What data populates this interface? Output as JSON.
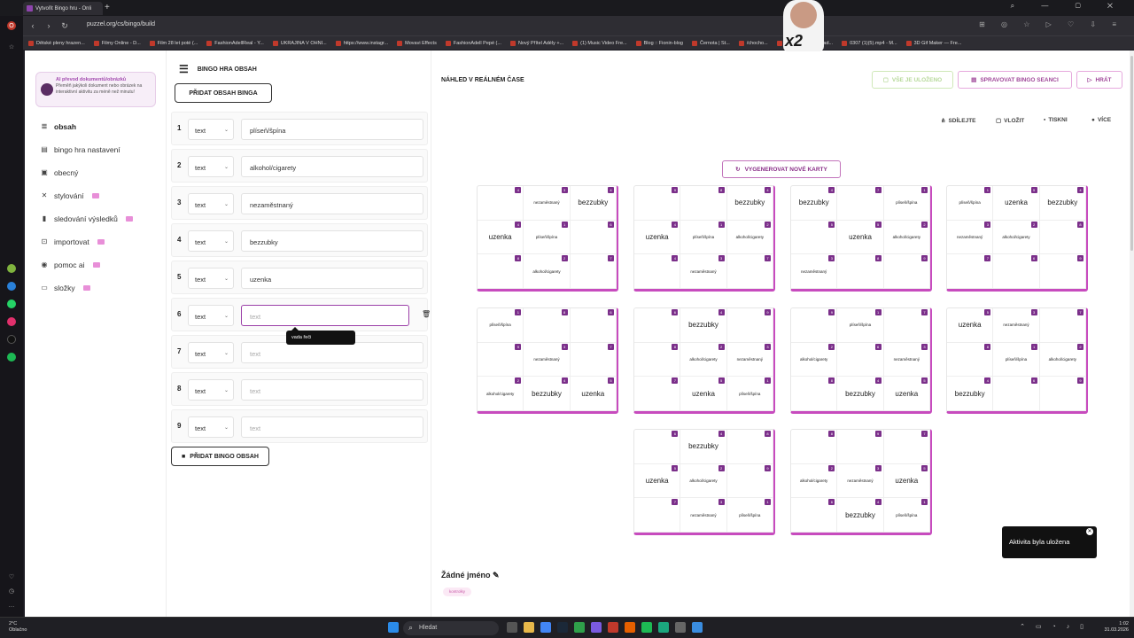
{
  "browser": {
    "tab_title": "Vytvořit Bingo hru - Onli",
    "url": "puzzel.org/cs/bingo/build",
    "bookmarks": [
      "Dětské pleny hrazen...",
      "Filmy Online - D...",
      "Film 28 let poté (...",
      "FashionAdellReal - Y...",
      "UKRAJINA V OHNI...",
      "https://www.instagr...",
      "Movavi Effects",
      "FashionAdell Pepé (...",
      "Nový Přítel Adély +...",
      "(1) Music Video Fre...",
      "Blog :: Fionin-blog",
      "Černota | St...",
      "/chocho...",
      "Kick VOD Download...",
      "0307 (1)(5).mp4 - M...",
      "3D Gif Maker — Fre..."
    ]
  },
  "sidebar": {
    "promo_title": "AI převod dokumentů/obrázků",
    "promo_text": "Přeměň jakýkoli dokument nebo obrázek na interaktivní aktivitu za méně než minutu!",
    "items": [
      {
        "label": "obsah",
        "icon": "list-icon"
      },
      {
        "label": "bingo hra nastavení",
        "icon": "settings-icon"
      },
      {
        "label": "obecný",
        "icon": "card-icon"
      },
      {
        "label": "stylování",
        "icon": "paint-icon"
      },
      {
        "label": "sledování výsledků",
        "icon": "chart-icon"
      },
      {
        "label": "importovat",
        "icon": "import-icon"
      },
      {
        "label": "pomoc ai",
        "icon": "ai-icon"
      },
      {
        "label": "složky",
        "icon": "folder-icon"
      }
    ]
  },
  "editor": {
    "title": "BINGO HRA OBSAH",
    "add_top": "PŘIDAT OBSAH BINGA",
    "add_bottom": "PŘIDAT BINGO OBSAH",
    "rows": [
      {
        "num": "1",
        "type": "text",
        "value": "plíseň/špína"
      },
      {
        "num": "2",
        "type": "text",
        "value": "alkohol/cigarety"
      },
      {
        "num": "3",
        "type": "text",
        "value": "nezaměstnaný"
      },
      {
        "num": "4",
        "type": "text",
        "value": "bezzubky"
      },
      {
        "num": "5",
        "type": "text",
        "value": "uzenka"
      },
      {
        "num": "6",
        "type": "text",
        "value": "",
        "placeholder": "text"
      },
      {
        "num": "7",
        "type": "text",
        "value": "",
        "placeholder": "text"
      },
      {
        "num": "8",
        "type": "text",
        "value": "",
        "placeholder": "text"
      },
      {
        "num": "9",
        "type": "text",
        "value": "",
        "placeholder": "text"
      }
    ],
    "tooltip": "vada řeči"
  },
  "preview": {
    "title": "NÁHLED V REÁLNÉM ČASE",
    "saved": "VŠE JE ULOŽENO",
    "manage": "SPRAVOVAT BINGO SEANCI",
    "play": "HRÁT",
    "share": "SDÍLEJTE",
    "embed": "VLOŽIT",
    "print": "TISKNI",
    "more": "VÍCE",
    "generate": "VYGENEROVAT NOVÉ KARTY",
    "name": "Žádné jméno",
    "tag": "kontrolky",
    "cards": [
      [
        [
          "",
          "4"
        ],
        [
          "nezaměstnaný",
          "3"
        ],
        [
          "bezzubky",
          "4"
        ],
        [
          "uzenka",
          "4"
        ],
        [
          "plíseň/špína",
          "1"
        ],
        [
          "",
          "6"
        ],
        [
          "",
          "8"
        ],
        [
          "alkohol/cigarety",
          "2"
        ],
        [
          "",
          "7"
        ]
      ],
      [
        [
          "",
          "9"
        ],
        [
          "",
          "8"
        ],
        [
          "bezzubky",
          "4"
        ],
        [
          "uzenka",
          "4"
        ],
        [
          "plíseň/špína",
          "1"
        ],
        [
          "alkohol/cigarety",
          "2"
        ],
        [
          "",
          "4"
        ],
        [
          "nezaměstnaný",
          "3"
        ],
        [
          "",
          "7"
        ]
      ],
      [
        [
          "bezzubky",
          "4"
        ],
        [
          "",
          "7"
        ],
        [
          "plíseň/špína",
          "1"
        ],
        [
          "",
          "5"
        ],
        [
          "uzenka",
          "5"
        ],
        [
          "alkohol/cigarety",
          "2"
        ],
        [
          "nezaměstnaný",
          "3"
        ],
        [
          "",
          "8"
        ],
        [
          "",
          "9"
        ]
      ],
      [
        [
          "plíseň/špína",
          "1"
        ],
        [
          "uzenka",
          "5"
        ],
        [
          "bezzubky",
          "4"
        ],
        [
          "nezaměstnaný",
          "3"
        ],
        [
          "alkohol/cigarety",
          "2"
        ],
        [
          "",
          "8"
        ],
        [
          "",
          "7"
        ],
        [
          "",
          "6"
        ],
        [
          "",
          "9"
        ]
      ],
      [
        [
          "plíseň/špína",
          "1"
        ],
        [
          "",
          "8"
        ],
        [
          "",
          "6"
        ],
        [
          "",
          "9"
        ],
        [
          "nezaměstnaný",
          "3"
        ],
        [
          "",
          "7"
        ],
        [
          "alkohol/cigarety",
          "2"
        ],
        [
          "bezzubky",
          "4"
        ],
        [
          "uzenka",
          "5"
        ]
      ],
      [
        [
          "",
          "6"
        ],
        [
          "bezzubky",
          "4"
        ],
        [
          "",
          "9"
        ],
        [
          "",
          "8"
        ],
        [
          "alkohol/cigarety",
          "2"
        ],
        [
          "nezaměstnaný",
          "3"
        ],
        [
          "",
          "7"
        ],
        [
          "uzenka",
          "5"
        ],
        [
          "plíseň/špína",
          "1"
        ]
      ],
      [
        [
          "",
          "9"
        ],
        [
          "plíseň/špína",
          "1"
        ],
        [
          "",
          "7"
        ],
        [
          "alkohol/cigarety",
          "2"
        ],
        [
          "",
          "6"
        ],
        [
          "nezaměstnaný",
          "3"
        ],
        [
          "",
          "8"
        ],
        [
          "bezzubky",
          "4"
        ],
        [
          "uzenka",
          "5"
        ]
      ],
      [
        [
          "uzenka",
          "5"
        ],
        [
          "nezaměstnaný",
          "3"
        ],
        [
          "",
          "7"
        ],
        [
          "",
          "8"
        ],
        [
          "plíseň/špína",
          "1"
        ],
        [
          "alkohol/cigarety",
          "2"
        ],
        [
          "bezzubky",
          "4"
        ],
        [
          "",
          "6"
        ],
        [
          "",
          "9"
        ]
      ],
      [
        [
          "",
          "6"
        ],
        [
          "bezzubky",
          "4"
        ],
        [
          "",
          "8"
        ],
        [
          "uzenka",
          "5"
        ],
        [
          "alkohol/cigarety",
          "2"
        ],
        [
          "",
          "9"
        ],
        [
          "",
          "7"
        ],
        [
          "nezaměstnaný",
          "3"
        ],
        [
          "plíseň/špína",
          "1"
        ]
      ],
      [
        [
          "",
          "8"
        ],
        [
          "",
          "9"
        ],
        [
          "",
          "7"
        ],
        [
          "alkohol/cigarety",
          "2"
        ],
        [
          "nezaměstnaný",
          "3"
        ],
        [
          "uzenka",
          "5"
        ],
        [
          "",
          "6"
        ],
        [
          "bezzubky",
          "4"
        ],
        [
          "plíseň/špína",
          "1"
        ]
      ]
    ]
  },
  "toast": "Aktivita byla uložena",
  "taskbar": {
    "weather_temp": "2°C",
    "weather_desc": "Oblačno",
    "search": "Hledat",
    "time": "1:02",
    "date": "31.03.2026"
  },
  "overlay": "x2",
  "colors": {
    "accent": "#9b3fa8",
    "card_border": "#c74bbe",
    "badge": "#7b2f8a"
  }
}
